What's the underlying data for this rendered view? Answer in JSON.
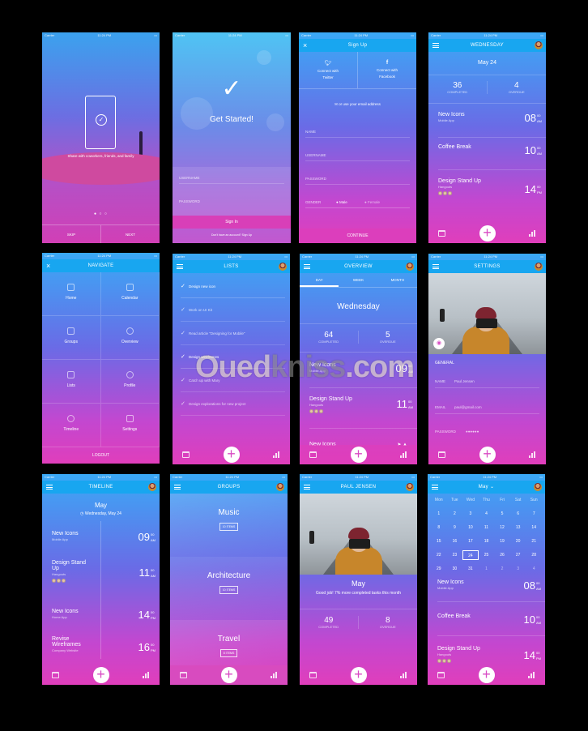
{
  "status": {
    "carrier": "Carrier",
    "time": "11:24 PM"
  },
  "s1": {
    "caption": "Share with coworkers, friends, and family",
    "skip": "SKIP",
    "next": "NEXT"
  },
  "s2": {
    "title": "Get Started!",
    "username": "USERNAME",
    "password": "PASSWORD",
    "signin": "Sign In",
    "footer": "Don't have an account? Sign Up"
  },
  "s3": {
    "title": "Sign Up",
    "twitter": "Connect with Twitter",
    "facebook": "Connect with Facebook",
    "email_alt": "or use your email address",
    "fields": [
      "NAME",
      "USERNAME",
      "PASSWORD"
    ],
    "gender": "GENDER",
    "male": "Male",
    "female": "Female",
    "cont": "CONTINUE"
  },
  "s4": {
    "title": "WEDNESDAY",
    "date": "May 24",
    "completed": "36",
    "completed_label": "COMPLETED",
    "overdue": "4",
    "overdue_label": "OVERDUE",
    "tasks": [
      {
        "t": "New Icons",
        "s": "Mobile App",
        "h": "08",
        "m": "00",
        "ap": "AM"
      },
      {
        "t": "Coffee Break",
        "s": "",
        "h": "10",
        "m": "00",
        "ap": "AM"
      },
      {
        "t": "Design Stand Up",
        "s": "Hangouts",
        "h": "14",
        "m": "00",
        "ap": "PM"
      }
    ]
  },
  "s5": {
    "title": "NAVIGATE",
    "items": [
      "Home",
      "Calendar",
      "Groups",
      "Overview",
      "Lists",
      "Profile",
      "Timeline",
      "Settings"
    ],
    "logout": "LOGOUT"
  },
  "s6": {
    "title": "LISTS",
    "items": [
      "Design new icon",
      "Work on UI Kit",
      "Read article \"Designing for Mobile\"",
      "Design wireframes",
      "Catch up with Mary",
      "Design explorations for new project"
    ]
  },
  "s7": {
    "title": "OVERVIEW",
    "tabs": [
      "DAY",
      "WEEK",
      "MONTH"
    ],
    "day": "Wednesday",
    "completed": "64",
    "completed_label": "COMPLETED",
    "overdue": "5",
    "overdue_label": "OVERDUE",
    "tasks": [
      {
        "t": "New Icons",
        "s": "Mobile App",
        "h": "09",
        "m": "00",
        "ap": "AM"
      },
      {
        "t": "Design Stand Up",
        "s": "Hangouts",
        "h": "11",
        "m": "00",
        "ap": "AM"
      },
      {
        "t": "New Icons",
        "s": "",
        "h": "",
        "m": "",
        "ap": ""
      }
    ]
  },
  "s8": {
    "title": "SETTINGS",
    "general": "GENERAL",
    "name_label": "NAME",
    "name": "Paul Jensen",
    "email_label": "EMAIL",
    "email": "paul@gmail.com",
    "password_label": "PASSWORD",
    "password": "●●●●●●"
  },
  "s9": {
    "title": "TIMELINE",
    "month": "May",
    "date": "Wednesday, May 24",
    "tasks": [
      {
        "t": "New Icons",
        "s": "Mobile App",
        "h": "09",
        "m": "00",
        "ap": "AM"
      },
      {
        "t": "Design Stand Up",
        "s": "Hangouts",
        "h": "11",
        "m": "00",
        "ap": "AM"
      },
      {
        "t": "New Icons",
        "s": "Home App",
        "h": "14",
        "m": "00",
        "ap": "PM"
      },
      {
        "t": "Revise Wireframes",
        "s": "Company Website",
        "h": "16",
        "m": "00",
        "ap": "PM"
      }
    ]
  },
  "s10": {
    "title": "GROUPS",
    "groups": [
      {
        "n": "Music",
        "c": "10 ITEMS"
      },
      {
        "n": "Architecture",
        "c": "10 ITEMS"
      },
      {
        "n": "Travel",
        "c": "8 ITEMS"
      }
    ]
  },
  "s11": {
    "title": "PAUL JENSEN",
    "month": "May",
    "msg": "Good job! 7% more completed tasks this month",
    "completed": "49",
    "completed_label": "COMPLETED",
    "overdue": "8",
    "overdue_label": "OVERDUE"
  },
  "s12": {
    "title": "May",
    "dows": [
      "Mon",
      "Tue",
      "Wed",
      "Thu",
      "Fri",
      "Sat",
      "Sun"
    ],
    "days": [
      "1",
      "2",
      "3",
      "4",
      "5",
      "6",
      "7",
      "8",
      "9",
      "10",
      "11",
      "12",
      "13",
      "14",
      "15",
      "16",
      "17",
      "18",
      "19",
      "20",
      "21",
      "22",
      "23",
      "24",
      "25",
      "26",
      "27",
      "28",
      "29",
      "30",
      "31",
      "1",
      "2",
      "3",
      "4"
    ],
    "tasks": [
      {
        "t": "New Icons",
        "s": "Mobile App",
        "h": "08",
        "m": "00",
        "ap": "AM"
      },
      {
        "t": "Coffee Break",
        "s": "",
        "h": "10",
        "m": "00",
        "ap": "AM"
      },
      {
        "t": "Design Stand Up",
        "s": "Hangouts",
        "h": "14",
        "m": "00",
        "ap": "PM"
      }
    ]
  },
  "watermark": {
    "a": "Oued",
    "b": "kniss",
    ".com": ".com"
  },
  "colors": {
    "nav": "#18a6f0",
    "top": "#3aa9f6",
    "bottom": "#e03ebb"
  }
}
